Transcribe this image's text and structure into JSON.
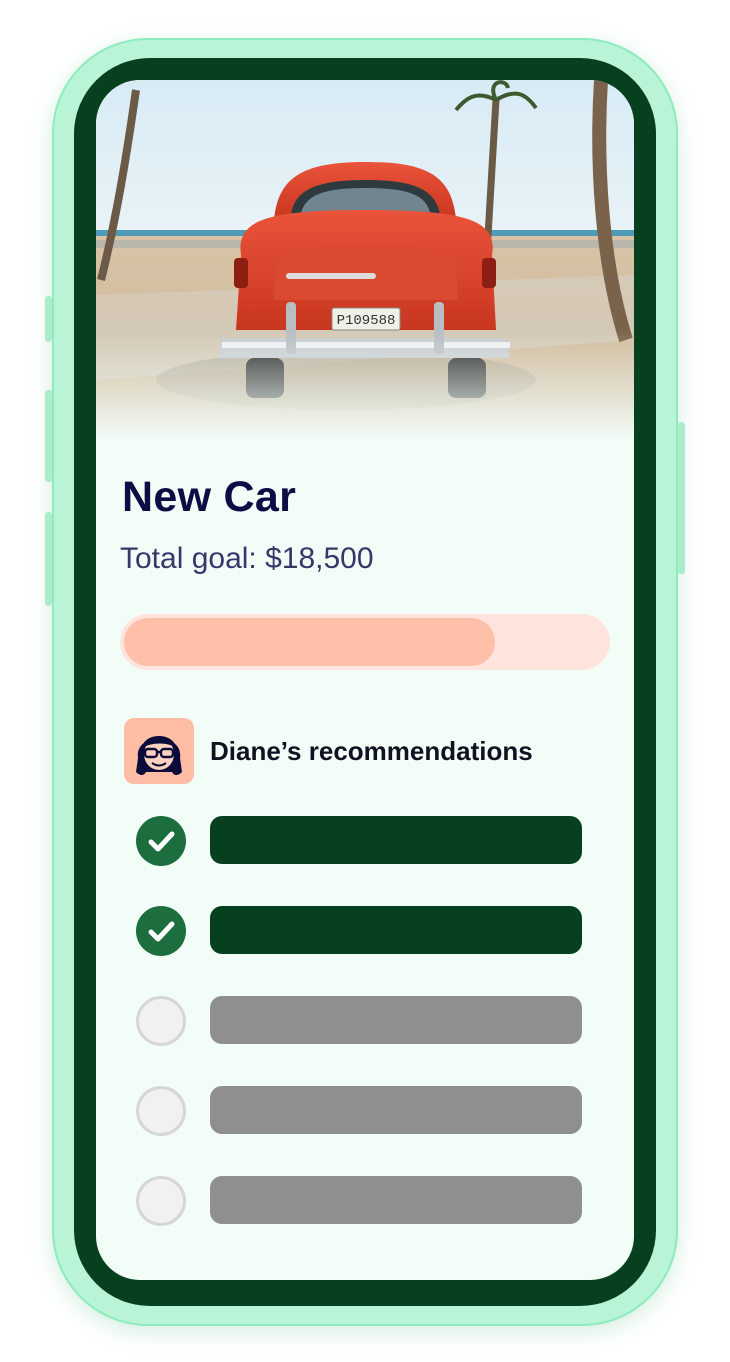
{
  "goal": {
    "title": "New Car",
    "total_label": "Total goal: $18,500",
    "progress_fraction": 0.77
  },
  "recommendations": {
    "title": "Diane’s recommendations",
    "items": [
      {
        "completed": true
      },
      {
        "completed": true
      },
      {
        "completed": false
      },
      {
        "completed": false
      },
      {
        "completed": false
      }
    ]
  },
  "hero_image": {
    "subject": "red classic car on beach road with palm trees",
    "plate": "P109588"
  },
  "colors": {
    "phone_frame": "#b9f4d6",
    "bezel": "#07401f",
    "screen_bg": "#f2fdf7",
    "title": "#0d0d45",
    "progress_track": "#ffe3dc",
    "progress_fill": "#ffc0aa",
    "check_done": "#1d6e3e",
    "bar_done": "#07401f",
    "bar_todo": "#8f8f8f"
  },
  "icons": {
    "check": "check-icon",
    "avatar": "diane-avatar"
  }
}
